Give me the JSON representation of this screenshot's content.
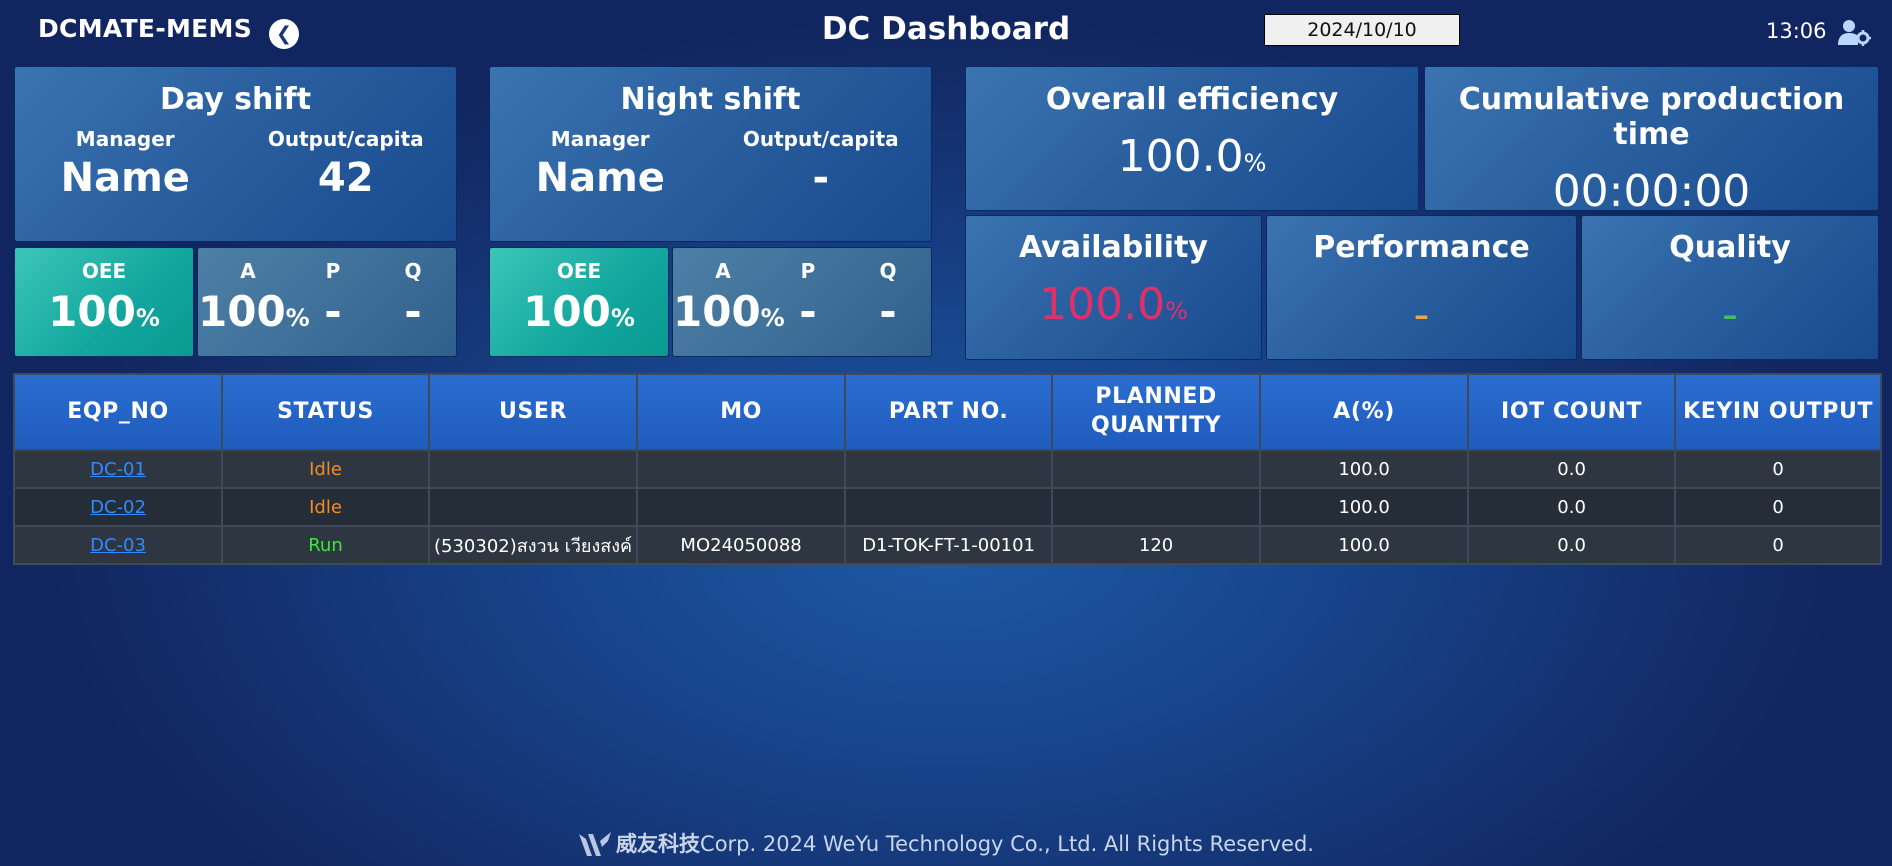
{
  "header": {
    "app_name": "DCMATE-MEMS",
    "title": "DC Dashboard",
    "date_value": "2024/10/10",
    "time": "13:06"
  },
  "day_shift": {
    "title": "Day shift",
    "manager_label": "Manager",
    "manager_value": "Name",
    "output_label": "Output/capita",
    "output_value": "42",
    "oee_label": "OEE",
    "oee_value": "100",
    "oee_unit": "%",
    "a_label": "A",
    "a_value": "100",
    "a_unit": "%",
    "p_label": "P",
    "p_value": "-",
    "q_label": "Q",
    "q_value": "-"
  },
  "night_shift": {
    "title": "Night shift",
    "manager_label": "Manager",
    "manager_value": "Name",
    "output_label": "Output/capita",
    "output_value": "-",
    "oee_label": "OEE",
    "oee_value": "100",
    "oee_unit": "%",
    "a_label": "A",
    "a_value": "100",
    "a_unit": "%",
    "p_label": "P",
    "p_value": "-",
    "q_label": "Q",
    "q_value": "-"
  },
  "overall": {
    "title": "Overall efficiency",
    "value": "100.0",
    "unit": "%"
  },
  "cumulative": {
    "title": "Cumulative production time",
    "value": "00:00:00"
  },
  "availability": {
    "title": "Availability",
    "value": "100.0",
    "unit": "%",
    "color": "#e0306a"
  },
  "performance": {
    "title": "Performance",
    "value": "-",
    "color": "#f0a640"
  },
  "quality": {
    "title": "Quality",
    "value": "-",
    "color": "#3fc25a"
  },
  "colors": {
    "idle": "#f08c28",
    "run": "#3ce63c",
    "link": "#2f8cff"
  },
  "table": {
    "headers": [
      "EQP_NO",
      "STATUS",
      "USER",
      "MO",
      "PART NO.",
      "PLANNED QUANTITY",
      "A(%)",
      "IOT COUNT",
      "KEYIN OUTPUT"
    ],
    "rows": [
      {
        "eqp": "DC-01",
        "status": "Idle",
        "user": "",
        "mo": "",
        "part": "",
        "planned": "",
        "a": "100.0",
        "iot": "0.0",
        "keyin": "0"
      },
      {
        "eqp": "DC-02",
        "status": "Idle",
        "user": "",
        "mo": "",
        "part": "",
        "planned": "",
        "a": "100.0",
        "iot": "0.0",
        "keyin": "0"
      },
      {
        "eqp": "DC-03",
        "status": "Run",
        "user": "(530302)สงวน เวียงสงค์",
        "mo": "MO24050088",
        "part": "D1-TOK-FT-1-00101",
        "planned": "120",
        "a": "100.0",
        "iot": "0.0",
        "keyin": "0"
      }
    ]
  },
  "footer": {
    "brand": "威友科技",
    "text": "Corp. 2024 WeYu Technology Co., Ltd. All Rights Reserved."
  }
}
